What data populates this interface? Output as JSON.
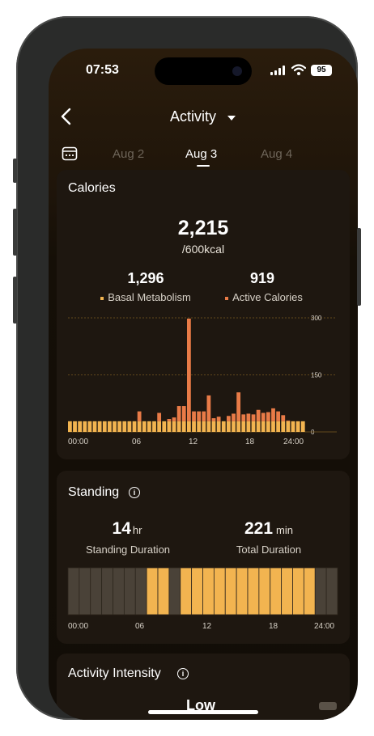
{
  "status": {
    "time": "07:53",
    "battery": "95"
  },
  "header": {
    "title": "Activity"
  },
  "date_tabs": [
    "Aug 2",
    "Aug 3",
    "Aug 4"
  ],
  "active_tab": "Aug 3",
  "calories": {
    "title": "Calories",
    "total": "2,215",
    "goal": "/600kcal",
    "basal_value": "1,296",
    "basal_label": "Basal Metabolism",
    "active_value": "919",
    "active_label": "Active Calories",
    "colors": {
      "basal": "#f2b450",
      "active": "#e97b47"
    }
  },
  "chart_data": {
    "type": "bar",
    "series": [
      {
        "name": "Basal Metabolism",
        "values": [
          28,
          28,
          28,
          28,
          28,
          28,
          28,
          28,
          28,
          28,
          28,
          28,
          28,
          28,
          28,
          28,
          28,
          28,
          28,
          28,
          28,
          28,
          28,
          28,
          28,
          28,
          28,
          28,
          28,
          28,
          28,
          28,
          28,
          28,
          28,
          28,
          28,
          28,
          28,
          28,
          28,
          28,
          28,
          28,
          28,
          28,
          28,
          28
        ]
      },
      {
        "name": "Active Calories",
        "values": [
          0,
          0,
          0,
          0,
          0,
          0,
          0,
          0,
          0,
          0,
          0,
          0,
          0,
          0,
          0,
          0,
          0,
          0,
          0,
          0,
          26,
          0,
          0,
          0,
          0,
          30,
          0,
          0,
          0,
          0,
          0,
          0,
          0,
          0,
          0,
          0,
          0,
          0,
          0,
          0,
          0,
          0,
          0,
          0,
          0,
          0,
          0,
          0,
          0,
          0,
          0,
          0,
          0,
          0,
          0,
          0
        ]
      }
    ],
    "bars": [
      {
        "basal": 28,
        "active": 0
      },
      {
        "basal": 28,
        "active": 0
      },
      {
        "basal": 28,
        "active": 0
      },
      {
        "basal": 28,
        "active": 0
      },
      {
        "basal": 28,
        "active": 0
      },
      {
        "basal": 28,
        "active": 0
      },
      {
        "basal": 28,
        "active": 0
      },
      {
        "basal": 28,
        "active": 0
      },
      {
        "basal": 28,
        "active": 0
      },
      {
        "basal": 28,
        "active": 0
      },
      {
        "basal": 28,
        "active": 0
      },
      {
        "basal": 28,
        "active": 0
      },
      {
        "basal": 28,
        "active": 0
      },
      {
        "basal": 28,
        "active": 0
      },
      {
        "basal": 28,
        "active": 26
      },
      {
        "basal": 28,
        "active": 0
      },
      {
        "basal": 28,
        "active": 0
      },
      {
        "basal": 28,
        "active": 0
      },
      {
        "basal": 28,
        "active": 22
      },
      {
        "basal": 28,
        "active": 0
      },
      {
        "basal": 28,
        "active": 6
      },
      {
        "basal": 28,
        "active": 10
      },
      {
        "basal": 28,
        "active": 40
      },
      {
        "basal": 28,
        "active": 40
      },
      {
        "basal": 28,
        "active": 270
      },
      {
        "basal": 28,
        "active": 26
      },
      {
        "basal": 28,
        "active": 26
      },
      {
        "basal": 28,
        "active": 26
      },
      {
        "basal": 28,
        "active": 68
      },
      {
        "basal": 28,
        "active": 8
      },
      {
        "basal": 28,
        "active": 12
      },
      {
        "basal": 28,
        "active": 0
      },
      {
        "basal": 28,
        "active": 14
      },
      {
        "basal": 28,
        "active": 20
      },
      {
        "basal": 28,
        "active": 76
      },
      {
        "basal": 28,
        "active": 18
      },
      {
        "basal": 28,
        "active": 20
      },
      {
        "basal": 28,
        "active": 18
      },
      {
        "basal": 28,
        "active": 30
      },
      {
        "basal": 28,
        "active": 22
      },
      {
        "basal": 28,
        "active": 24
      },
      {
        "basal": 28,
        "active": 34
      },
      {
        "basal": 28,
        "active": 26
      },
      {
        "basal": 28,
        "active": 16
      },
      {
        "basal": 28,
        "active": 2
      },
      {
        "basal": 28,
        "active": 0
      },
      {
        "basal": 28,
        "active": 0
      },
      {
        "basal": 28,
        "active": 0
      }
    ],
    "x_ticks": [
      "00:00",
      "06",
      "12",
      "18",
      "24:00"
    ],
    "y_ticks": [
      "300",
      "150",
      "0"
    ],
    "ylim": [
      0,
      300
    ]
  },
  "standing": {
    "title": "Standing",
    "duration_value": "14",
    "duration_unit": "hr",
    "duration_label": "Standing Duration",
    "total_value": "221",
    "total_unit": "min",
    "total_label": "Total Duration",
    "hours": [
      0,
      0,
      0,
      0,
      0,
      0,
      0,
      1,
      1,
      0,
      1,
      1,
      1,
      1,
      1,
      1,
      1,
      1,
      1,
      1,
      1,
      1,
      0,
      0
    ],
    "colors": {
      "on": "#f2b450",
      "off": "#4a4238"
    },
    "x_ticks": [
      "00:00",
      "06",
      "12",
      "18",
      "24:00"
    ]
  },
  "intensity": {
    "title": "Activity Intensity",
    "value": "Low"
  }
}
